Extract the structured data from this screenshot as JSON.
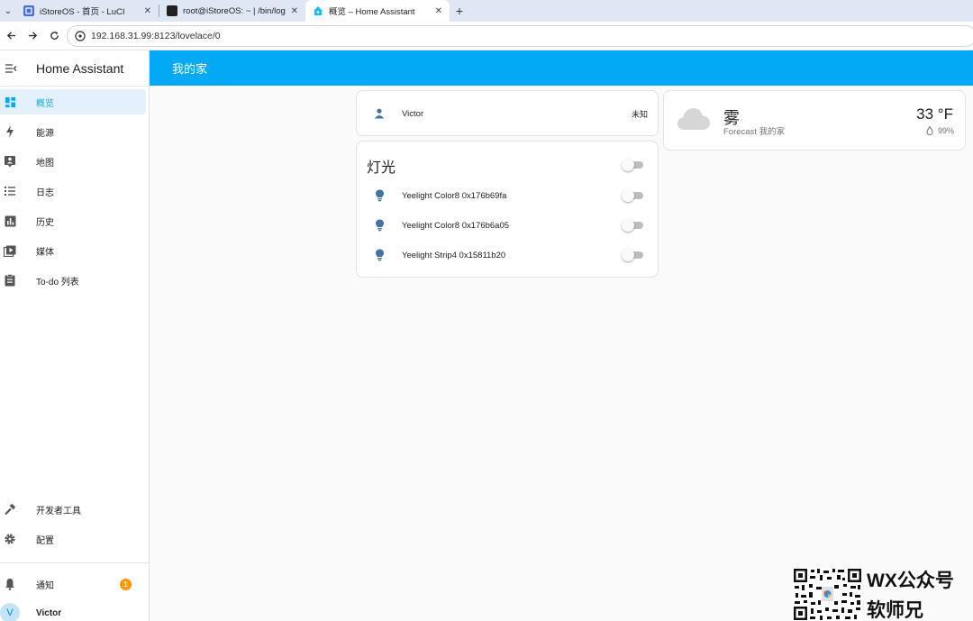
{
  "browser": {
    "tabs": [
      {
        "title": "iStoreOS - 首页 - LuCI",
        "close": "✕"
      },
      {
        "title": "root@iStoreOS: ~ | /bin/login",
        "close": "✕"
      },
      {
        "title": "概览 – Home Assistant",
        "close": "✕"
      }
    ],
    "new_tab": "+",
    "menu_glyph": "⌄",
    "url": "192.168.31.99:8123/lovelace/0"
  },
  "sidebar": {
    "title": "Home Assistant",
    "items": [
      {
        "label": "概览",
        "icon": "dashboard-icon"
      },
      {
        "label": "能源",
        "icon": "lightning-icon"
      },
      {
        "label": "地图",
        "icon": "map-person-icon"
      },
      {
        "label": "日志",
        "icon": "list-icon"
      },
      {
        "label": "历史",
        "icon": "chart-icon"
      },
      {
        "label": "媒体",
        "icon": "media-icon"
      },
      {
        "label": "To-do 列表",
        "icon": "clipboard-icon"
      }
    ],
    "bottom_items": [
      {
        "label": "开发者工具",
        "icon": "hammer-icon"
      },
      {
        "label": "配置",
        "icon": "gear-icon"
      }
    ],
    "notifications": {
      "label": "通知",
      "count": "1"
    },
    "user": {
      "name": "Victor",
      "initial": "V"
    }
  },
  "header": {
    "title": "我的家"
  },
  "person_card": {
    "name": "Victor",
    "state": "未知"
  },
  "lights_card": {
    "title": "灯光",
    "lights": [
      {
        "name": "Yeelight Color8 0x176b69fa"
      },
      {
        "name": "Yeelight Color8 0x176b6a05"
      },
      {
        "name": "Yeelight Strip4 0x15811b20"
      }
    ]
  },
  "weather_card": {
    "condition": "雾",
    "subtitle": "Forecast 我的家",
    "temperature": "33 °F",
    "humidity": "99%"
  },
  "watermark": {
    "line1": "WX公众号",
    "line2": "软师兄"
  },
  "colors": {
    "accent": "#03a9f4",
    "icon": "#44739e",
    "badge": "#ff9800"
  }
}
